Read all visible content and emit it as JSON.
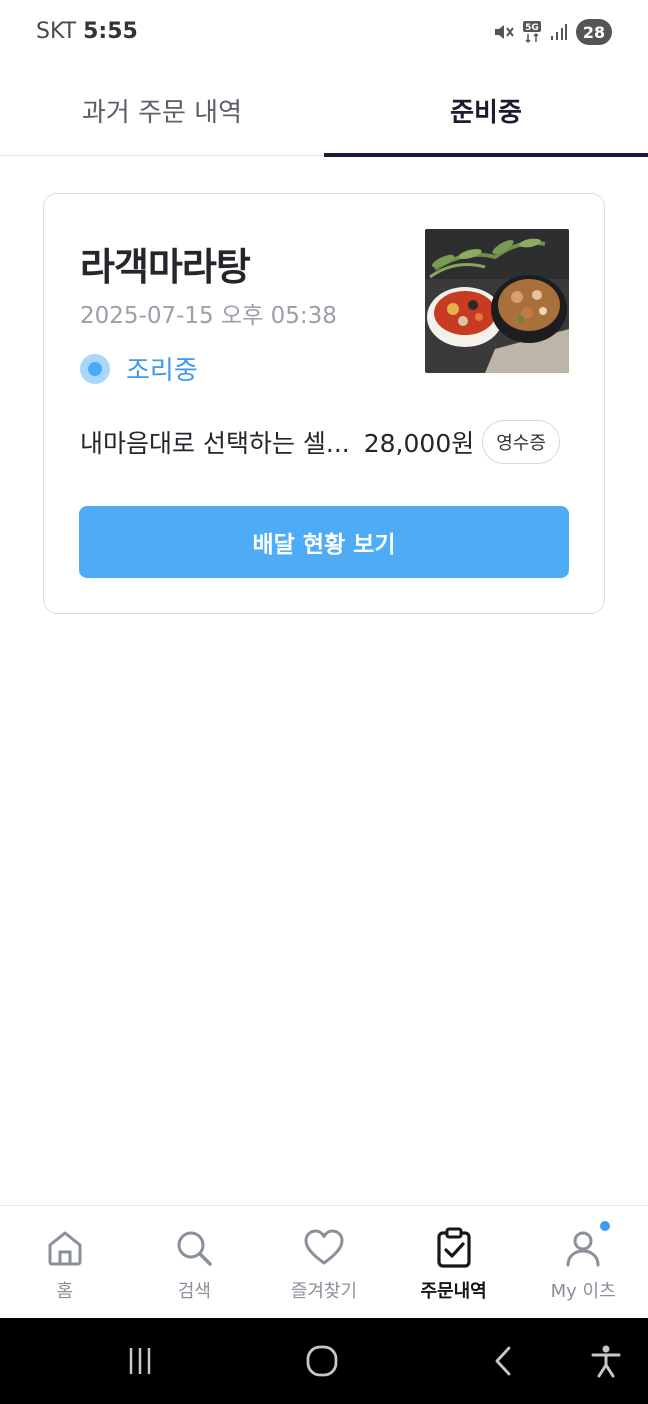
{
  "status_bar": {
    "carrier": "SKT",
    "time": "5:55",
    "network": "5G",
    "battery": "28"
  },
  "tabs": [
    {
      "label": "과거 주문 내역",
      "active": false
    },
    {
      "label": "준비중",
      "active": true
    }
  ],
  "order": {
    "store_name": "라객마라탕",
    "date": "2025-07-15 오후 05:38",
    "status": "조리중",
    "menu": "내마음대로 선택하는 셀...",
    "price": "28,000원",
    "receipt_label": "영수증",
    "track_button_label": "배달 현황 보기"
  },
  "bottom_nav": [
    {
      "label": "홈",
      "icon": "home-icon"
    },
    {
      "label": "검색",
      "icon": "search-icon"
    },
    {
      "label": "즐겨찾기",
      "icon": "heart-icon"
    },
    {
      "label": "주문내역",
      "icon": "clipboard-check-icon",
      "active": true
    },
    {
      "label": "My 이츠",
      "icon": "person-icon",
      "badge": true
    }
  ],
  "colors": {
    "accent": "#4eacf6",
    "status_text": "#3e9ae8",
    "tab_indicator": "#1b1a3a"
  }
}
